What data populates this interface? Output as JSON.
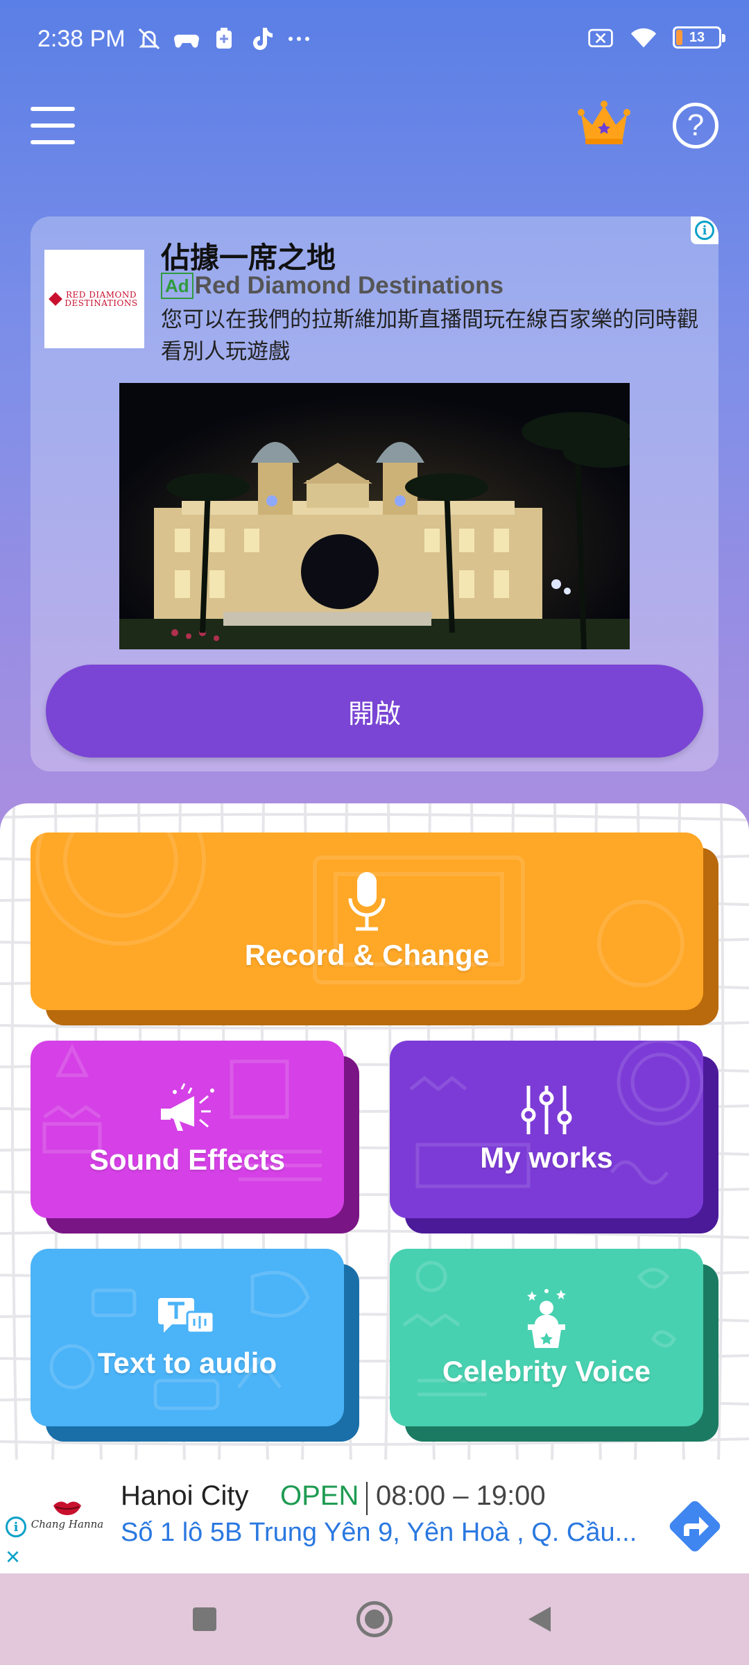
{
  "status_bar": {
    "time": "2:38 PM",
    "icons": [
      "mute-icon",
      "game-controller-icon",
      "battery-saver-icon",
      "tiktok-icon",
      "more-icon"
    ],
    "right_icons": [
      "sim-off-icon",
      "wifi-icon",
      "battery-icon"
    ],
    "battery_level": "13",
    "battery_accent": "#ff9a3c"
  },
  "app_bar": {
    "menu_icon": "menu-icon",
    "crown_icon": "crown-icon",
    "help_label": "?"
  },
  "ad": {
    "headline": "佔據一席之地",
    "badge": "Ad",
    "advertiser": "Red Diamond Destinations",
    "body": "您可以在我們的拉斯維加斯直播間玩在線百家樂的同時觀看別人玩遊戲",
    "logo_text_1": "RED DIAMOND",
    "logo_text_2": "DESTINATIONS",
    "cta": "開啟",
    "info_label": "i",
    "cta_color": "#7a45d4"
  },
  "features": {
    "record": {
      "label": "Record & Change",
      "icon": "microphone-icon",
      "color": "#ffa726",
      "shadow": "#b86a0c"
    },
    "sound_effects": {
      "label": "Sound Effects",
      "icon": "megaphone-icon",
      "color": "#d541e6",
      "shadow": "#7a1585"
    },
    "my_works": {
      "label": "My works",
      "icon": "equalizer-icon",
      "color": "#7c3bd6",
      "shadow": "#4b1a99"
    },
    "text_to_audio": {
      "label": "Text to audio",
      "icon": "text-to-speech-icon",
      "color": "#4bb3f7",
      "shadow": "#1a6fa8"
    },
    "celebrity_voice": {
      "label": "Celebrity Voice",
      "icon": "celebrity-icon",
      "color": "#47d1b0",
      "shadow": "#1b7b62"
    }
  },
  "banner": {
    "name": "Hanoi City",
    "status": "OPEN",
    "hours": "08:00 – 19:00",
    "address": "Số 1 lô 5B Trung Yên 9, Yên Hoà , Q. Cầu...",
    "logo_text": "Chang Hanna",
    "info_label": "i",
    "close_label": "×",
    "open_color": "#1e9b52",
    "address_color": "#2a78e0"
  },
  "nav_bar": {
    "recents_icon": "recents-icon",
    "home_icon": "home-icon",
    "back_icon": "back-icon"
  }
}
